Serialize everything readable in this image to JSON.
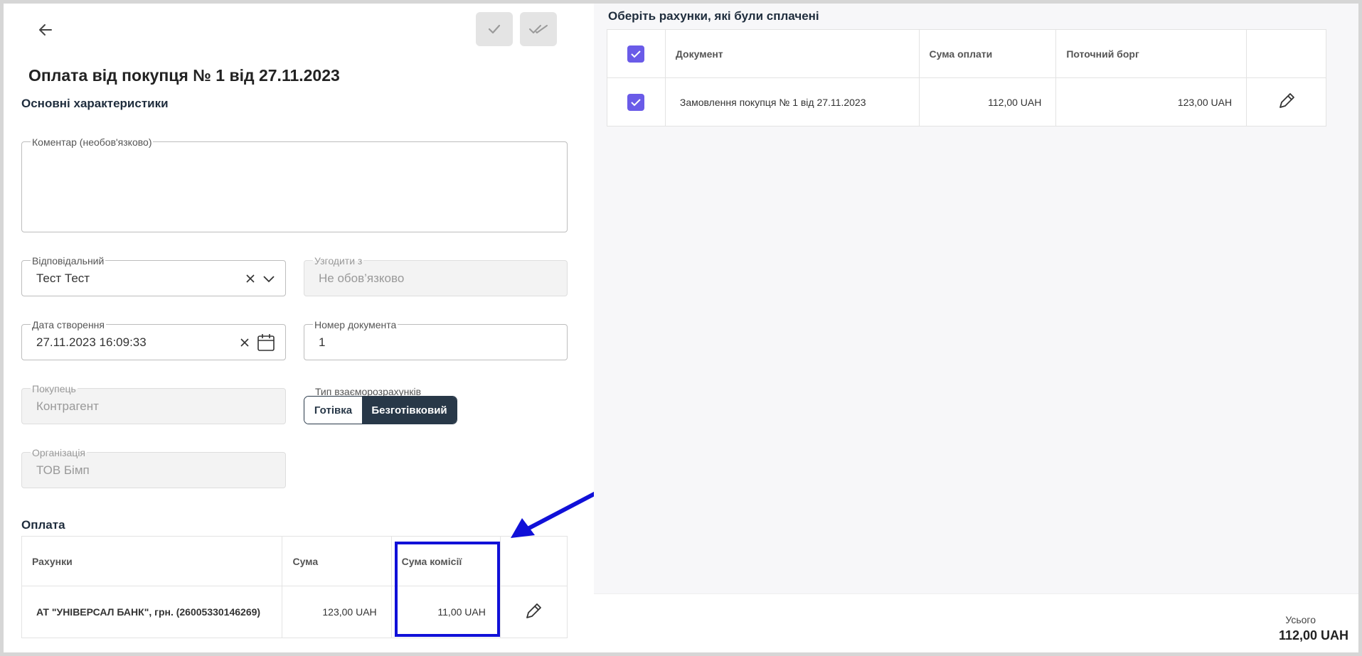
{
  "header": {
    "title": "Оплата від покупця № 1 від 27.11.2023"
  },
  "section_main": "Основні характеристики",
  "comment": {
    "label": "Коментар (необов'язково)",
    "value": ""
  },
  "responsible": {
    "label": "Відповідальний",
    "value": "Тест Тест"
  },
  "approve_with": {
    "label": "Узгодити з",
    "placeholder": "Не обов’язково"
  },
  "created_date": {
    "label": "Дата створення",
    "value": "27.11.2023 16:09:33"
  },
  "doc_number": {
    "label": "Номер документа",
    "value": "1"
  },
  "buyer": {
    "label": "Покупець",
    "value": "Контрагент"
  },
  "settlement_type": {
    "label": "Тип взаєморозрахунків",
    "options": [
      "Готівка",
      "Безготівковий"
    ],
    "selected": "Безготівковий"
  },
  "organization": {
    "label": "Організація",
    "value": "ТОВ Бімп"
  },
  "payment": {
    "section": "Оплата",
    "columns": [
      "Рахунки",
      "Сума",
      "Сума комісії"
    ],
    "rows": [
      {
        "account": "АТ \"УНІВЕРСАЛ БАНК\", грн. (26005330146269)",
        "amount": "123,00 UAH",
        "commission": "11,00 UAH"
      }
    ]
  },
  "invoices": {
    "title": "Оберіть рахунки, які були сплачені",
    "columns": [
      "Документ",
      "Сума оплати",
      "Поточний борг"
    ],
    "rows": [
      {
        "document": "Замовлення покупця № 1 від 27.11.2023",
        "paid": "112,00 UAH",
        "debt": "123,00 UAH"
      }
    ]
  },
  "footer": {
    "total_label": "Усього",
    "total_value": "112,00 UAH"
  },
  "colors": {
    "accent": "#6a5be8",
    "dark": "#283848",
    "annotation": "#1010d8"
  },
  "icons": [
    "arrow-left-icon",
    "check-icon",
    "double-check-icon",
    "clear-icon",
    "chevron-down-icon",
    "calendar-icon",
    "pencil-icon",
    "checkbox-icon"
  ]
}
